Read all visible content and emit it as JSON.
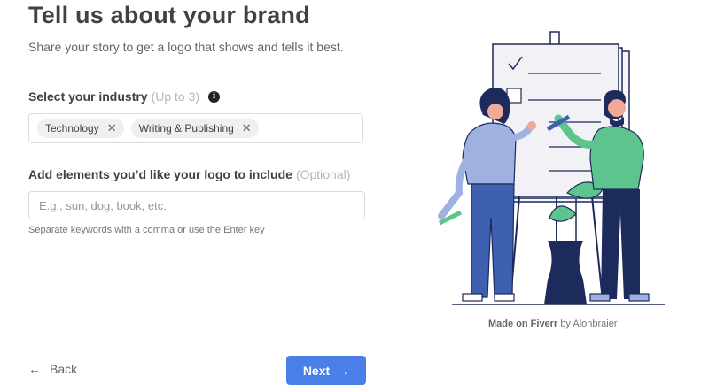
{
  "header": {
    "title": "Tell us about your brand",
    "subtitle": "Share your story to get a logo that shows and tells it best."
  },
  "industry": {
    "label": "Select your industry",
    "limit": "(Up to 3)",
    "info_icon": "info-icon",
    "tags": [
      {
        "label": "Technology",
        "remove_icon": "close-icon"
      },
      {
        "label": "Writing & Publishing",
        "remove_icon": "close-icon"
      }
    ]
  },
  "elements": {
    "label": "Add elements you’d like your logo to include",
    "optional": "(Optional)",
    "placeholder": "E.g., sun, dog, book, etc.",
    "value": "",
    "hint": "Separate keywords with a comma or use the Enter key"
  },
  "illustration": {
    "credit_brand": "Made on Fiverr",
    "credit_author": "by Alonbraier"
  },
  "footer": {
    "back_label": "Back",
    "next_label": "Next",
    "back_icon": "arrow-left-icon",
    "next_icon": "arrow-right-icon"
  },
  "colors": {
    "primary": "#4a7fe8",
    "text": "#404145",
    "muted": "#b5b6ba",
    "border": "#dadbdd",
    "tag_bg": "#efeff0"
  }
}
